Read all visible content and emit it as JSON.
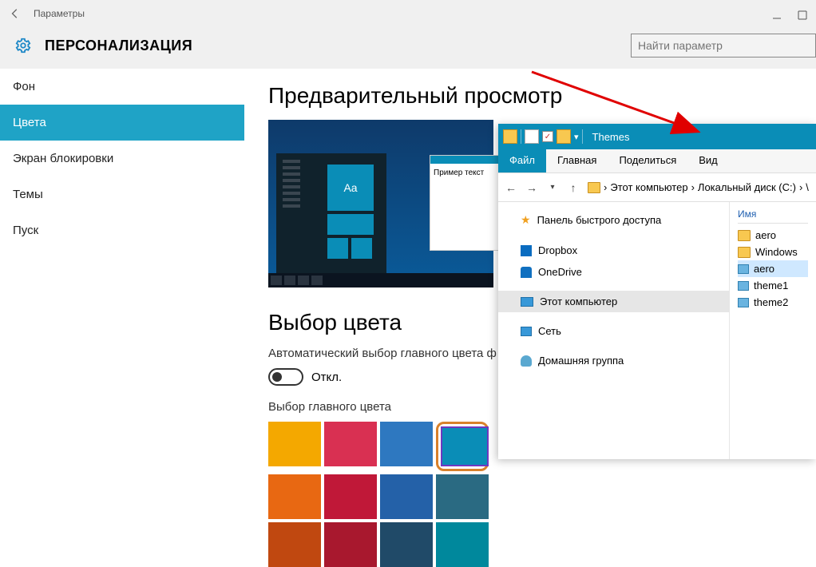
{
  "window": {
    "title": "Параметры"
  },
  "section_title": "ПЕРСОНАЛИЗАЦИЯ",
  "search": {
    "placeholder": "Найти параметр"
  },
  "sidebar": {
    "items": [
      {
        "label": "Фон"
      },
      {
        "label": "Цвета"
      },
      {
        "label": "Экран блокировки"
      },
      {
        "label": "Темы"
      },
      {
        "label": "Пуск"
      }
    ]
  },
  "main": {
    "preview_heading": "Предварительный просмотр",
    "preview_popup_label": "Пример текст",
    "preview_tile_label": "Aa",
    "color_heading": "Выбор цвета",
    "auto_caption": "Автоматический выбор главного цвета ф",
    "toggle_label": "Откл.",
    "pick_caption": "Выбор главного цвета",
    "colors_row1": [
      "#f4a800",
      "#d93052",
      "#2e78c0",
      "#0a8db7"
    ],
    "colors_row2": [
      "#e86812",
      "#c01838",
      "#2461a8",
      "#2a6a82"
    ],
    "colors_row3": [
      "#c04810",
      "#a8182e",
      "#204a68",
      "#00889c"
    ]
  },
  "explorer": {
    "title": "Themes",
    "tabs": {
      "file": "Файл",
      "home": "Главная",
      "share": "Поделиться",
      "view": "Вид"
    },
    "breadcrumb": [
      "Этот компьютер",
      "Локальный диск (C:)"
    ],
    "side_items": [
      {
        "label": "Панель быстрого доступа",
        "icon": "star"
      },
      {
        "label": "Dropbox",
        "icon": "dropbox"
      },
      {
        "label": "OneDrive",
        "icon": "onedrive"
      },
      {
        "label": "Этот компьютер",
        "icon": "pc",
        "active": true
      },
      {
        "label": "Сеть",
        "icon": "net"
      },
      {
        "label": "Домашняя группа",
        "icon": "home"
      }
    ],
    "list_header": "Имя",
    "list_items": [
      {
        "label": "aero",
        "icon": "folder"
      },
      {
        "label": "Windows",
        "icon": "folder"
      },
      {
        "label": "aero",
        "icon": "theme",
        "selected": true
      },
      {
        "label": "theme1",
        "icon": "theme"
      },
      {
        "label": "theme2",
        "icon": "theme"
      }
    ]
  }
}
